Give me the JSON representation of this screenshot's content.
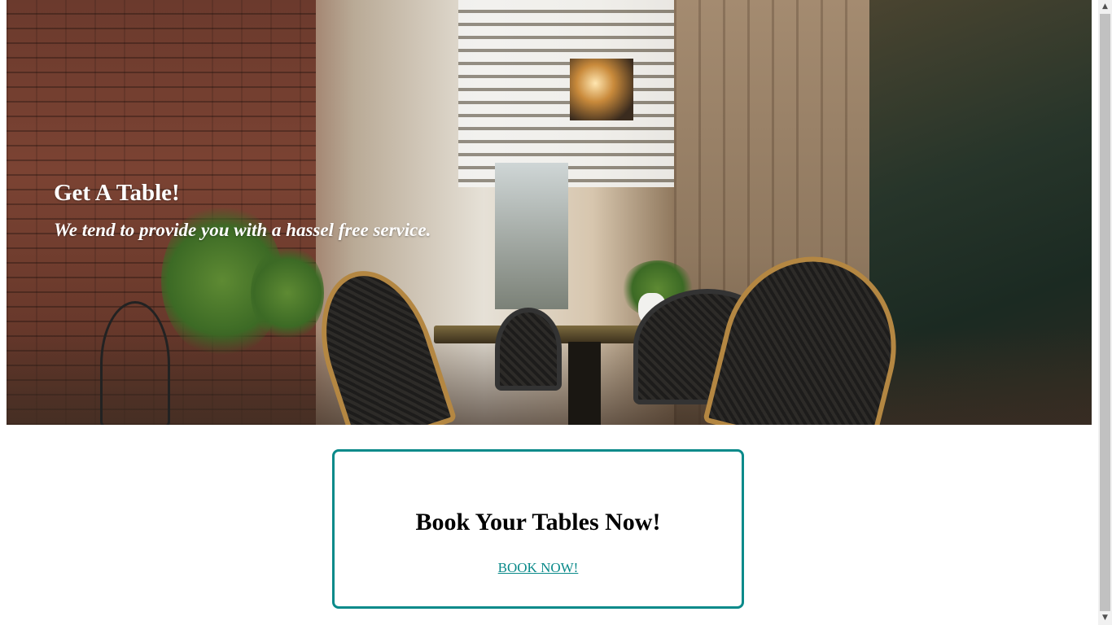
{
  "hero": {
    "title": "Get A Table!",
    "subtitle": "We tend to provide you with a hassel free service."
  },
  "booking": {
    "title": "Book Your Tables Now!",
    "link_label": "BOOK NOW!"
  },
  "colors": {
    "accent": "#0a8a8a",
    "hero_text": "#ffffff"
  },
  "icons": {
    "scroll_up": "▲",
    "scroll_down": "▼"
  }
}
